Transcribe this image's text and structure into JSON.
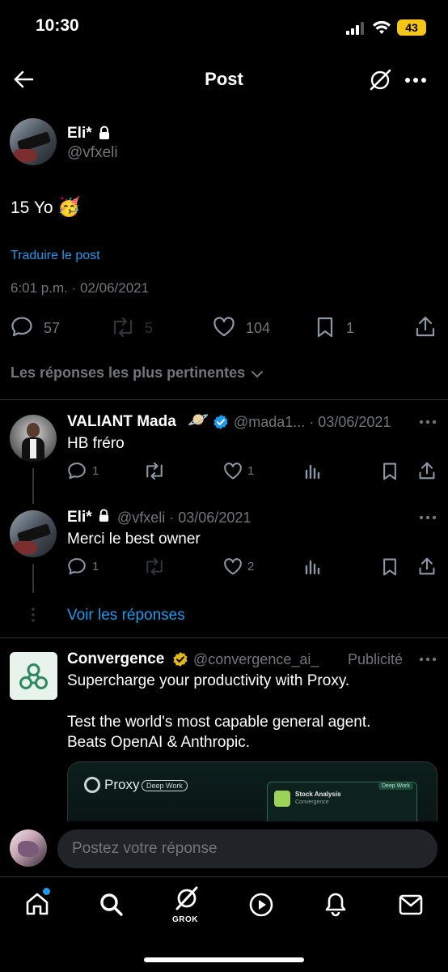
{
  "status_bar": {
    "time": "10:30",
    "battery": "43"
  },
  "header": {
    "title": "Post"
  },
  "post": {
    "author_name": "Eli*",
    "author_handle": "@vfxeli",
    "text": "15 Yo",
    "emoji": "🥳",
    "translate_link": "Traduire le post",
    "timestamp": "6:01 p.m. · 02/06/2021",
    "stats": {
      "replies": "57",
      "reposts": "5",
      "likes": "104",
      "bookmarks": "1"
    }
  },
  "replies_sort": {
    "label": "Les réponses les plus pertinentes"
  },
  "replies": [
    {
      "name": "VALIANT Mada",
      "badge_emoji": "🪐",
      "meta": "@mada1... · 03/06/2021",
      "text": "HB fréro",
      "stats": {
        "replies": "1",
        "reposts": "",
        "likes": "1"
      }
    },
    {
      "name": "Eli*",
      "meta": "@vfxeli · 03/06/2021",
      "text": "Merci le best owner",
      "stats": {
        "replies": "1",
        "reposts": "",
        "likes": "2"
      }
    }
  ],
  "see_replies": {
    "label": "Voir les réponses"
  },
  "ad": {
    "name": "Convergence",
    "handle": "@convergence_ai_",
    "sponsored_label": "Publicité",
    "text_line1": "Supercharge your productivity with Proxy.",
    "text_line2": "Test the world's most capable general agent.",
    "text_line3": "Beats OpenAI & Anthropic.",
    "card": {
      "brand": "Proxy",
      "badge": "Deep Work",
      "panel_title": "Stock Analysis",
      "panel_subtitle": "Convergence",
      "panel_badge": "Deep Work"
    }
  },
  "reply_composer": {
    "placeholder": "Postez votre réponse"
  },
  "tabbar": {
    "grok_label": "GROK"
  },
  "colors": {
    "accent": "#1d9bf0",
    "verified_gold": "#e2b719",
    "background": "#000000"
  }
}
